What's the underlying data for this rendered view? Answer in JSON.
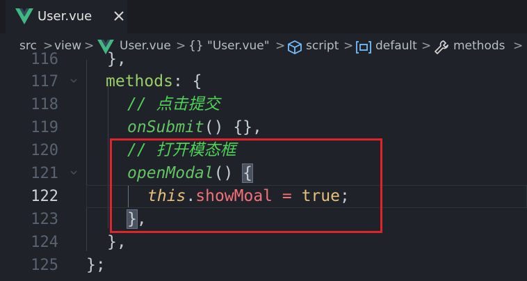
{
  "tab": {
    "icon": "vue-logo-icon",
    "label": "User.vue",
    "close_icon": "close-icon"
  },
  "breadcrumb": {
    "items": [
      {
        "label": "src"
      },
      {
        "label": "view"
      },
      {
        "icon": "vue-logo-icon",
        "label": "User.vue"
      },
      {
        "icon": "braces-icon",
        "label": "{} \"User.vue\""
      },
      {
        "icon": "cube-icon",
        "label": "script"
      },
      {
        "icon": "module-icon",
        "label": "default"
      },
      {
        "icon": "wrench-icon",
        "label": "methods"
      }
    ],
    "separator": ">"
  },
  "editor": {
    "active_line": "122",
    "lines": [
      {
        "number": "116",
        "text": "},"
      },
      {
        "number": "117",
        "text": "methods: {"
      },
      {
        "number": "118",
        "text": "// 点击提交"
      },
      {
        "number": "119",
        "text": "onSubmit() {},"
      },
      {
        "number": "120",
        "text": "// 打开模态框"
      },
      {
        "number": "121",
        "text": "openModal() {"
      },
      {
        "number": "122",
        "text": "this.showMoal = true;"
      },
      {
        "number": "123",
        "text": "},"
      },
      {
        "number": "124",
        "text": "},"
      },
      {
        "number": "125",
        "text": "};"
      }
    ]
  },
  "tokens": {
    "l116": "},",
    "l117_prop": "methods",
    "l117_rest": ": {",
    "l118": "// 点击提交",
    "l119_fn": "onSubmit",
    "l119_rest": "() {},",
    "l120": "// 打开模态框",
    "l121_fn": "openModal",
    "l121_paren": "() ",
    "l121_brace": "{",
    "l122_this": "this",
    "l122_dot": ".",
    "l122_member": "showMoal",
    "l122_eq": " = ",
    "l122_bool": "true",
    "l122_semi": ";",
    "l123_brace": "}",
    "l123_comma": ",",
    "l124": "},",
    "l125": "};"
  },
  "colors": {
    "annotation_box": "#e0242e",
    "background": "#1f2228",
    "comment": "#4fd15a"
  }
}
